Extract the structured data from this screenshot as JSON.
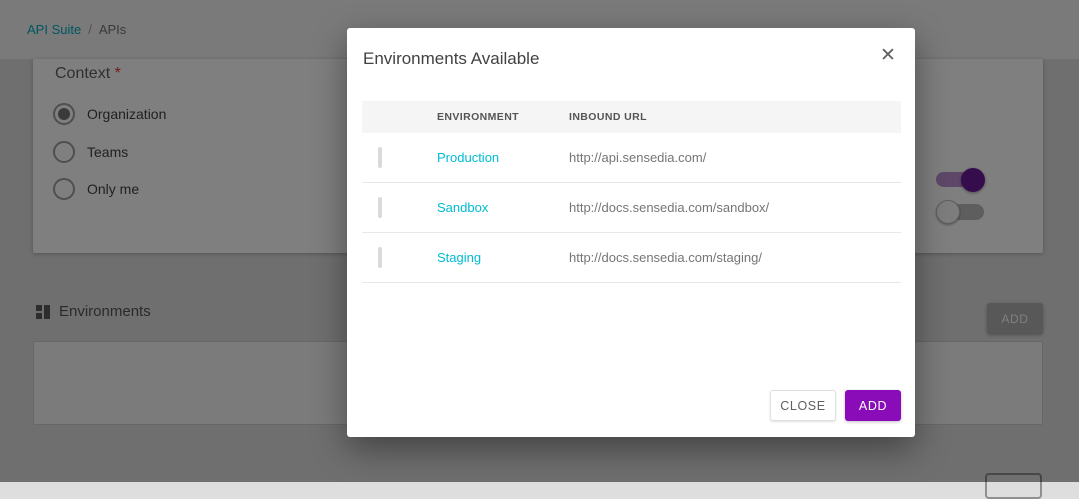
{
  "breadcrumb": {
    "items": [
      {
        "label": "API Suite"
      },
      {
        "label": "APIs"
      }
    ],
    "separator": "/"
  },
  "background": {
    "context": {
      "label": "Context",
      "required_marker": "*",
      "options": [
        {
          "label": "Organization",
          "selected": true
        },
        {
          "label": "Teams",
          "selected": false
        },
        {
          "label": "Only me",
          "selected": false
        }
      ],
      "toggles": [
        {
          "name": "toggle-1",
          "state": "on"
        },
        {
          "name": "toggle-2",
          "state": "off"
        }
      ]
    },
    "environments_section": {
      "title": "Environments",
      "add_button_label": "ADD"
    }
  },
  "modal": {
    "title": "Environments Available",
    "close_icon": "✕",
    "table": {
      "columns": [
        "ENVIRONMENT",
        "INBOUND URL"
      ],
      "rows": [
        {
          "environment": "Production",
          "inbound_url": "http://api.sensedia.com/",
          "checked": false
        },
        {
          "environment": "Sandbox",
          "inbound_url": "http://docs.sensedia.com/sandbox/",
          "checked": false
        },
        {
          "environment": "Staging",
          "inbound_url": "http://docs.sensedia.com/staging/",
          "checked": false
        }
      ]
    },
    "footer": {
      "close_label": "CLOSE",
      "add_label": "ADD"
    }
  },
  "colors": {
    "accent_teal": "#00bcd4",
    "breadcrumb_link": "#00acc1",
    "accent_purple": "#8a0cb8",
    "toggle_purple": "#6a1b9a",
    "required_red": "#e53935",
    "scrim": "rgba(0,0,0,0.5)"
  }
}
